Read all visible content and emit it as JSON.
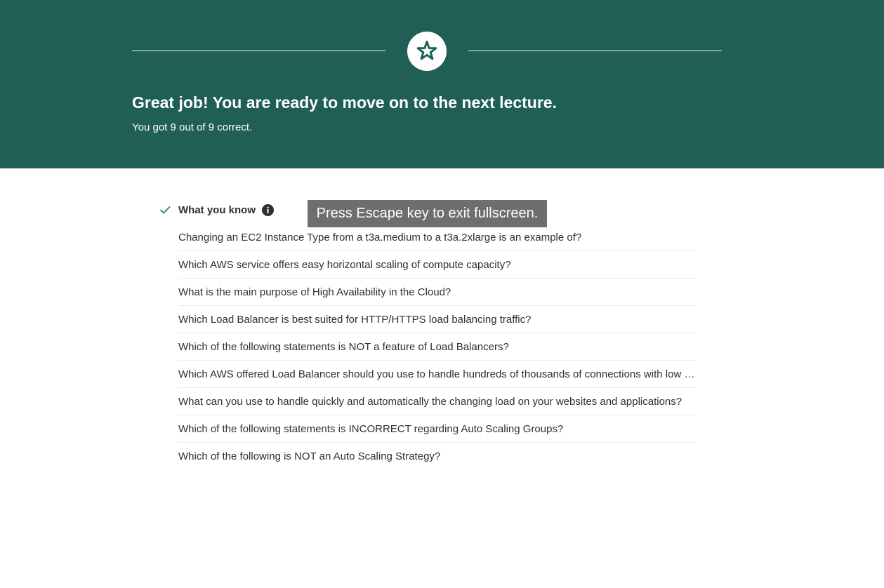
{
  "banner": {
    "icon": "star-icon",
    "title": "Great job! You are ready to move on to the next lecture.",
    "subtitle": "You got 9 out of 9 correct.",
    "background_color": "#1f5f56"
  },
  "knowledge": {
    "check_icon": "checkmark-icon",
    "title": "What you know",
    "info_icon": "info-icon",
    "accent_color": "#1e8a72"
  },
  "toast": {
    "message": "Press Escape key to exit fullscreen."
  },
  "questions": [
    "Changing an EC2 Instance Type from a t3a.medium to a t3a.2xlarge is an example of?",
    "Which AWS service offers easy horizontal scaling of compute capacity?",
    "What is the main purpose of High Availability in the Cloud?",
    "Which Load Balancer is best suited for HTTP/HTTPS load balancing traffic?",
    "Which of the following statements is NOT a feature of Load Balancers?",
    "Which AWS offered Load Balancer should you use to handle hundreds of thousands of connections with low latency?",
    "What can you use to handle quickly and automatically the changing load on your websites and applications?",
    "Which of the following statements is INCORRECT regarding Auto Scaling Groups?",
    "Which of the following is NOT an Auto Scaling Strategy?"
  ]
}
